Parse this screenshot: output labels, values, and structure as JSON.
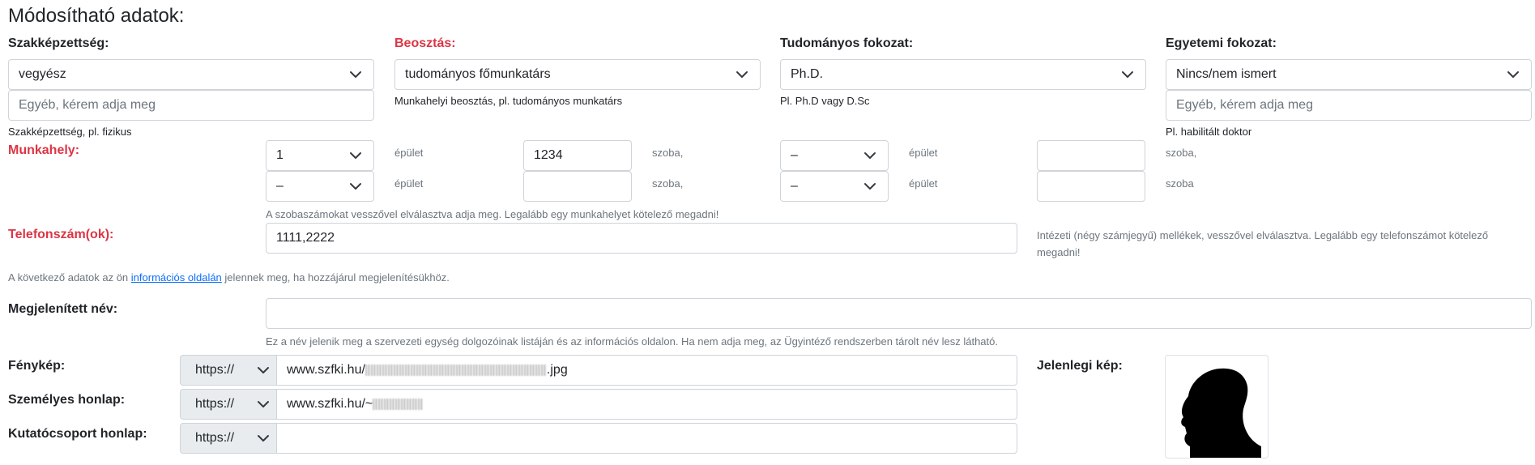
{
  "page_title": "Módosítható adatok:",
  "labels": {
    "szakkepzettseg": "Szakképzettség:",
    "beosztas": "Beosztás:",
    "tudomanyos_fokozat": "Tudományos fokozat:",
    "egyetemi_fokozat": "Egyetemi fokozat:",
    "munkahely": "Munkahely:",
    "telefonszam": "Telefonszám(ok):",
    "megjelenitett_nev": "Megjelenített név:",
    "fenykep": "Fénykép:",
    "szemelyes_honlap": "Személyes honlap:",
    "kutatocsoport_honlap": "Kutatócsoport honlap:",
    "jelenlegi_kep": "Jelenlegi kép:"
  },
  "selects": {
    "szakkepzettseg": "vegyész",
    "beosztas": "tudományos főmunkatárs",
    "tudomanyos_fokozat": "Ph.D.",
    "egyetemi_fokozat": "Nincs/nem ismert"
  },
  "inputs": {
    "szakkepzettseg_egyeb_placeholder": "Egyéb, kérem adja meg",
    "egyetemi_egyeb_placeholder": "Egyéb, kérem adja meg",
    "telefon_value": "1111,2222",
    "megjelenitett_nev_value": "",
    "fenykep_url_prefix": "www.szfki.hu/",
    "fenykep_url_suffix": ".jpg",
    "szemelyes_url_prefix": "www.szfki.hu/~",
    "kutatocsoport_url_value": ""
  },
  "help_texts": {
    "szakkepzettseg": "Szakképzettség, pl. fizikus",
    "beosztas": "Munkahelyi beosztás, pl. tudományos munkatárs",
    "tudomanyos_fokozat": "Pl. Ph.D vagy D.Sc",
    "egyetemi_fokozat": "Pl. habilitált doktor",
    "munkahely": "A szobaszámokat vesszővel elválasztva adja meg. Legalább egy munkahelyet kötelező megadni!",
    "telefon": "Intézeti (négy számjegyű) mellékek, vesszővel elválasztva. Legalább egy telefonszámot kötelező megadni!",
    "info_before": "A következő adatok az ön ",
    "info_link": "információs oldalán",
    "info_after": " jelennek meg, ha hozzájárul megjelenítésükhöz.",
    "megjelenitett_nev": "Ez a név jelenik meg a szervezeti egység dolgozóinak listáján és az információs oldalon. Ha nem adja meg, az Ügyintéző rendszerben tárolt név lesz látható."
  },
  "munkahely": {
    "row1": {
      "epulet1": "1",
      "unit_epulet1": "épület",
      "szoba1": "1234",
      "unit_szoba1": "szoba,",
      "epulet2": "–",
      "unit_epulet2": "épület",
      "szoba2": "",
      "unit_szoba2": "szoba,"
    },
    "row2": {
      "epulet1": "–",
      "unit_epulet1": "épület",
      "szoba1": "",
      "unit_szoba1": "szoba,",
      "epulet2": "–",
      "unit_epulet2": "épület",
      "szoba2": "",
      "unit_szoba2": "szoba"
    }
  },
  "protocol_selects": {
    "fenykep": "https://",
    "szemelyes": "https://",
    "kutatocsoport": "https://"
  },
  "icons": {
    "select_arrow": "chevron-down-icon",
    "photo": "silhouette-portrait-icon"
  },
  "colors": {
    "required_label": "#dc3545",
    "link": "#0d6efd",
    "border": "#ced4da",
    "addon_bg": "#e9ecef"
  }
}
